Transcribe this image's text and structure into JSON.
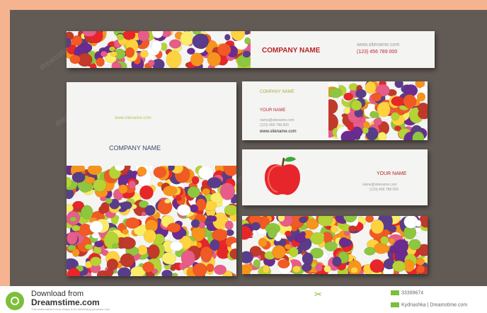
{
  "banner": {
    "company": "COMPANY NAME",
    "site": "www.sitename.com",
    "phone": "(123) 456 789 000"
  },
  "tall_card": {
    "site": "www.sitename.com",
    "company": "COMPANY NAME"
  },
  "card_top": {
    "company": "COMPANY NAME",
    "your_name": "YOUR NAME",
    "email": "name@sitename.com",
    "phone": "(123) 456 789 000",
    "site": "www.sitename.com"
  },
  "card_mid": {
    "your_name": "YOUR NAME",
    "email": "name@sitename.com",
    "phone": "(123) 456 789 000"
  },
  "watermark": "dreamstime",
  "footer": {
    "download_line": "Download from",
    "brand": "Dreamstime.com",
    "fine_print": "This watermarked comp image is for previewing purposes only.",
    "image_id": "33399674",
    "credit": "Kydriashka | Dreamstime.com"
  }
}
